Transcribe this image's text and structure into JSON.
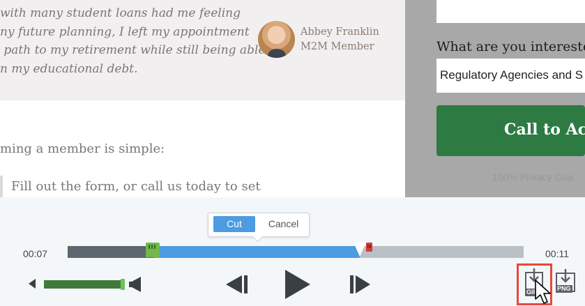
{
  "webpage": {
    "testimonial": {
      "lines": [
        "with many student loans had me feeling",
        "ny future planning, I left my appointment",
        " path to my retirement while still being able",
        "n my educational debt."
      ],
      "member_name": "Abbey Franklin",
      "member_role": "M2M Member"
    },
    "member_intro": "ming a member is simple:",
    "step_one": "Fill out the form, or call us today to set",
    "form": {
      "interest_label": "What are you intereste",
      "interest_value": "Regulatory Agencies and S",
      "cta_label": "Call to Acti",
      "privacy_text": "100% Privacy Gua"
    }
  },
  "editor": {
    "popover": {
      "cut_label": "Cut",
      "cancel_label": "Cancel"
    },
    "time_start": "00:07",
    "time_end": "00:11",
    "timeline": {
      "played_fraction": 0.19,
      "selection_start_fraction": 0.19,
      "selection_end_fraction": 0.64,
      "end_marker_fraction": 0.655
    },
    "volume_fraction": 0.98,
    "export": {
      "gif_label": "GIF",
      "png_label": "PNG"
    },
    "colors": {
      "accent_blue": "#4d9be0",
      "selection_green": "#72b84a",
      "end_marker_red": "#d93a3a",
      "highlight_red": "#e8483b",
      "cta_green": "#2e7a43"
    },
    "icons": [
      "volume-min-icon",
      "volume-max-icon",
      "previous-frame-icon",
      "play-icon",
      "next-frame-icon",
      "export-gif-icon",
      "export-png-icon",
      "mouse-cursor-icon"
    ]
  }
}
